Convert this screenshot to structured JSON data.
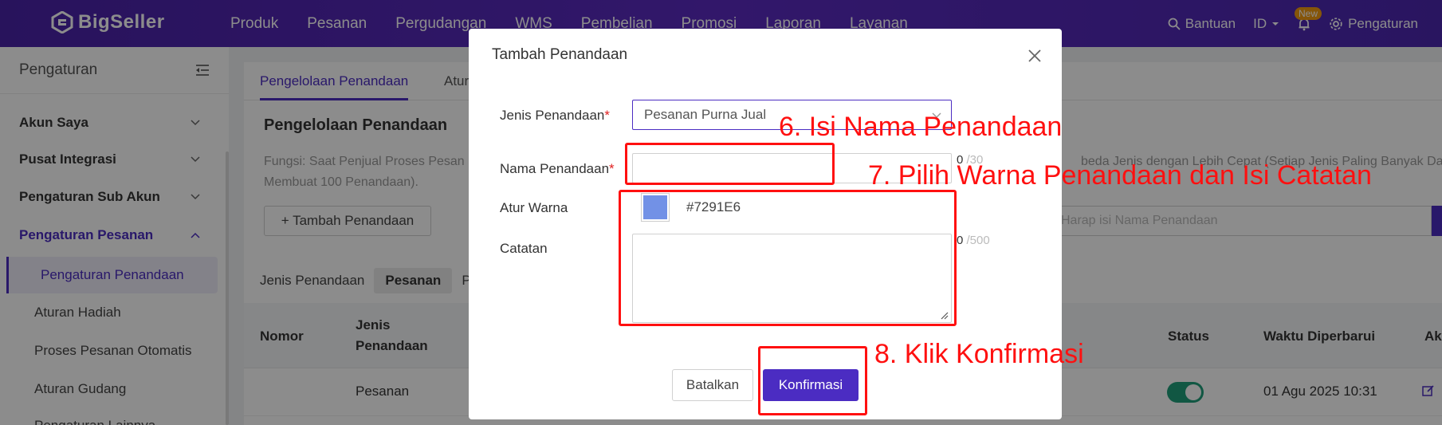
{
  "topbar": {
    "brand": "BigSeller",
    "nav": [
      "Produk",
      "Pesanan",
      "Pergudangan",
      "WMS",
      "Pembelian",
      "Promosi",
      "Laporan",
      "Layanan"
    ],
    "help_label": "Bantuan",
    "lang_label": "ID",
    "new_badge": "New",
    "settings_label": "Pengaturan"
  },
  "sidebar": {
    "title": "Pengaturan",
    "groups": [
      {
        "label": "Akun Saya"
      },
      {
        "label": "Pusat Integrasi"
      },
      {
        "label": "Pengaturan Sub Akun"
      },
      {
        "label": "Pengaturan Pesanan"
      }
    ],
    "subitems": [
      {
        "label": "Pengaturan Penandaan"
      },
      {
        "label": "Aturan Hadiah"
      },
      {
        "label": "Proses Pesanan Otomatis"
      },
      {
        "label": "Aturan Gudang"
      },
      {
        "label": "Pengaturan Lainnya"
      }
    ]
  },
  "main": {
    "tabs": [
      {
        "label": "Pengelolaan Penandaan"
      },
      {
        "label": "Atur"
      }
    ],
    "title": "Pengelolaan Penandaan",
    "desc_line1_left": "Fungsi: Saat Penjual Proses Pesan",
    "desc_line1_right": "beda Jenis dengan Lebih Cepat (Setiap Jenis Paling Banyak Dapat",
    "desc_line2": "Membuat 100 Penandaan).",
    "add_button": "+ Tambah Penandaan",
    "search_placeholder": "Harap isi Nama Penandaan",
    "type_label": "Jenis Penandaan",
    "type_active": "Pesanan",
    "type_other": "P",
    "table": {
      "headers": {
        "no": "Nomor",
        "type_line1": "Jenis",
        "type_line2": "Penandaan",
        "status": "Status",
        "updated": "Waktu Diperbarui",
        "action": "Ak"
      },
      "row": {
        "type": "Pesanan",
        "updated": "01 Agu 2025 10:31"
      }
    }
  },
  "modal": {
    "title": "Tambah Penandaan",
    "type_label": "Jenis Penandaan",
    "type_value": "Pesanan Purna Jual",
    "name_label": "Nama Penandaan",
    "name_count": "0",
    "name_max": "/30",
    "color_label": "Atur Warna",
    "color_value": "#7291E6",
    "note_label": "Catatan",
    "note_count": "0",
    "note_max": "/500",
    "required_mark": "*",
    "cancel_button": "Batalkan",
    "confirm_button": "Konfirmasi"
  },
  "annotations": {
    "step6": "6. Isi Nama Penandaan",
    "step7": "7. Pilih Warna Penandaan dan Isi Catatan",
    "step8": "8. Klik Konfirmasi"
  },
  "colors": {
    "brand": "#4b2cc2",
    "annotation": "#ff1010",
    "swatch": "#7291E6",
    "toggle_on": "#1f9e7a"
  }
}
